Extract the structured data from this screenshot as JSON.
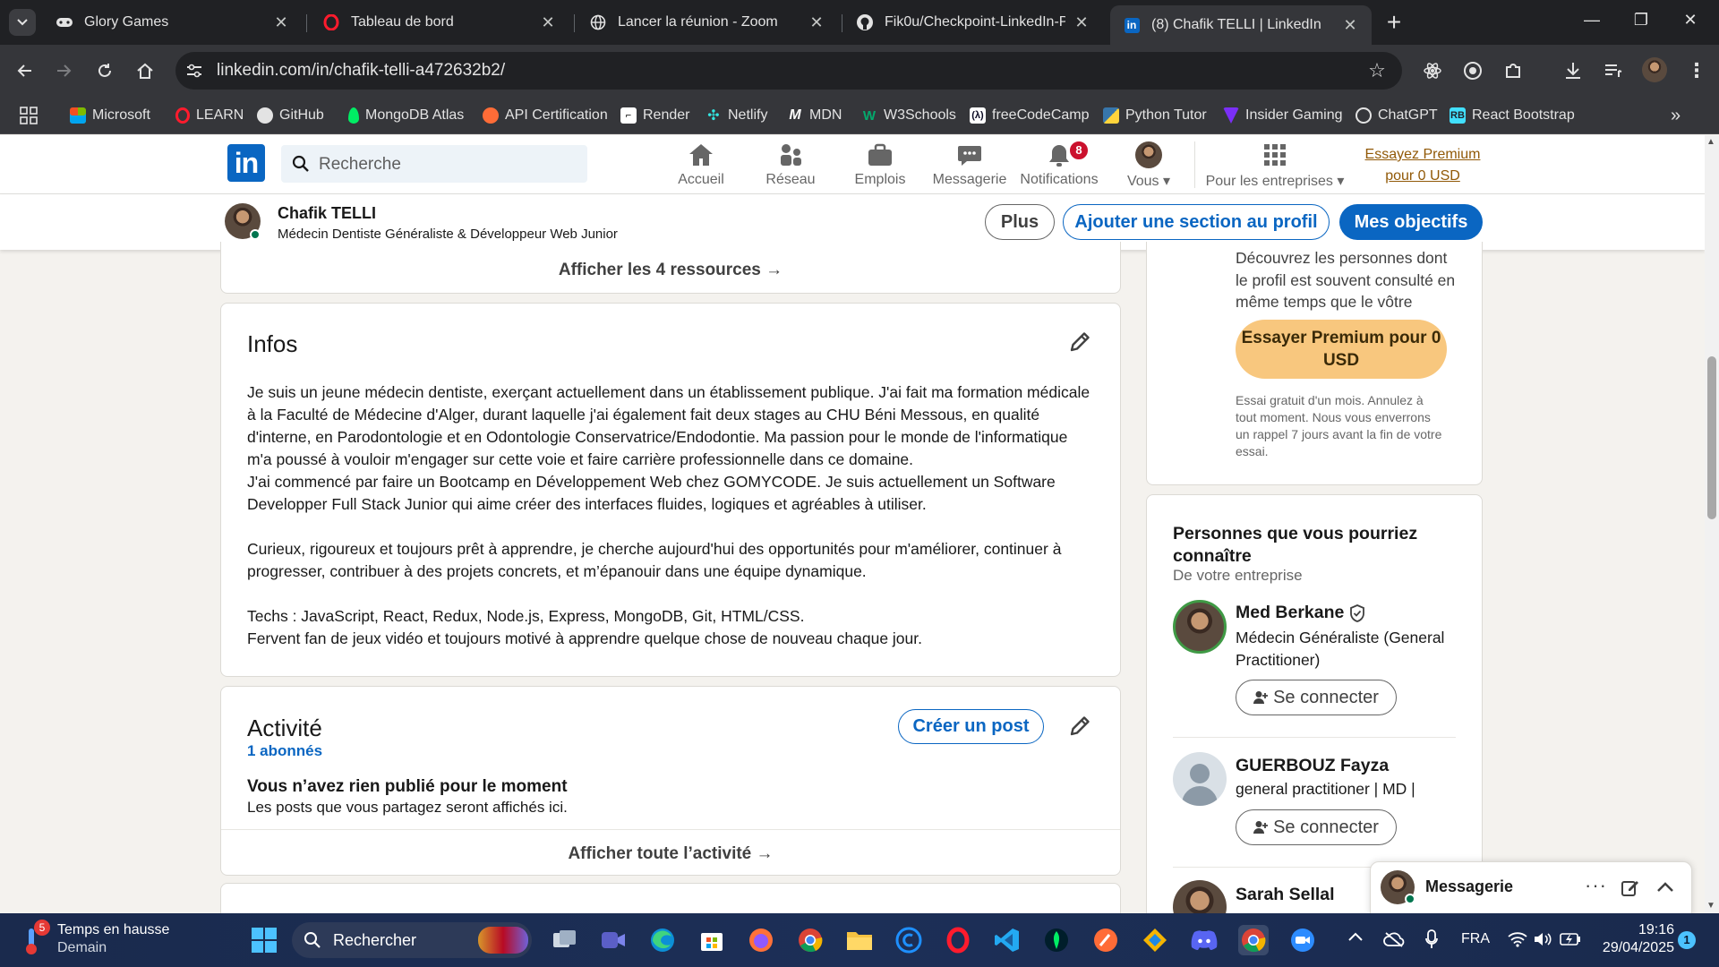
{
  "browser": {
    "tabs": [
      {
        "title": "Glory Games",
        "icon": "gamepad-icon"
      },
      {
        "title": "Tableau de bord",
        "icon": "opera-icon"
      },
      {
        "title": "Lancer la réunion - Zoom",
        "icon": "globe-icon"
      },
      {
        "title": "Fik0u/Checkpoint-LinkedIn-Pro",
        "icon": "github-icon"
      },
      {
        "title": "(8) Chafik TELLI | LinkedIn",
        "icon": "linkedin-icon",
        "active": true
      }
    ],
    "new_tab_label": "+",
    "url": "linkedin.com/in/chafik-telli-a472632b2/",
    "bookmarks": [
      "Microsoft",
      "LEARN",
      "GitHub",
      "MongoDB Atlas",
      "API Certification",
      "Render",
      "Netlify",
      "MDN",
      "W3Schools",
      "freeCodeCamp",
      "Python Tutor",
      "Insider Gaming",
      "ChatGPT",
      "React Bootstrap"
    ]
  },
  "linkedin": {
    "search_placeholder": "Recherche",
    "nav": {
      "home": "Accueil",
      "network": "Réseau",
      "jobs": "Emplois",
      "messaging": "Messagerie",
      "notifications": "Notifications",
      "notifications_count": "8",
      "me": "Vous",
      "business": "Pour les entreprises"
    },
    "premium_link": "Essayez Premium pour 0 USD",
    "profile_bar": {
      "name": "Chafik TELLI",
      "headline": "Médecin Dentiste Généraliste & Développeur Web Junior",
      "more": "Plus",
      "add_section": "Ajouter une section au profil",
      "goals": "Mes objectifs"
    },
    "resources_link": "Afficher les 4 ressources →",
    "about": {
      "title": "Infos",
      "p1": "Je suis un jeune médecin dentiste, exerçant actuellement dans un établissement publique. J'ai fait ma formation médicale à la Faculté de Médecine d'Alger, durant laquelle j'ai également fait deux stages au CHU Béni Messous, en qualité d'interne, en Parodontologie et en Odontologie Conservatrice/Endodontie. Ma passion pour le monde de l'informatique m'a poussé à vouloir m'engager sur cette voie et faire carrière professionnelle dans ce domaine.",
      "p2": "J'ai commencé par faire un Bootcamp en Développement Web chez GOMYCODE. Je suis actuellement un Software Developper Full Stack Junior qui aime créer des interfaces fluides, logiques et agréables à utiliser.",
      "p3": "Curieux, rigoureux et toujours prêt à apprendre, je cherche aujourd'hui des opportunités pour m'améliorer, continuer à progresser, contribuer à des projets concrets, et m’épanouir dans une équipe dynamique.",
      "p4": "Techs : JavaScript, React, Redux, Node.js, Express, MongoDB, Git, HTML/CSS.",
      "p5": "Fervent fan de jeux vidéo et toujours motivé à apprendre quelque chose de nouveau chaque jour."
    },
    "activity": {
      "title": "Activité",
      "followers": "1 abonnés",
      "create_post": "Créer un post",
      "empty_title": "Vous n’avez rien publié pour le moment",
      "empty_sub": "Les posts que vous partagez seront affichés ici.",
      "show_all": "Afficher toute l’activité →"
    },
    "premium_card": {
      "text": "Découvrez les personnes dont le profil est souvent consulté en même temps que le vôtre",
      "button": "Essayer Premium pour 0 USD",
      "note": "Essai gratuit d'un mois. Annulez à tout moment. Nous vous enverrons un rappel 7 jours avant la fin de votre essai."
    },
    "pymk": {
      "title": "Personnes que vous pourriez connaître",
      "subtitle": "De votre entreprise",
      "people": [
        {
          "name": "Med Berkane",
          "headline": "Médecin Généraliste (General Practitioner)",
          "verified": true
        },
        {
          "name": "GUERBOUZ Fayza",
          "headline": "general practitioner | MD |"
        },
        {
          "name": "Sarah Sellal",
          "headline": ""
        }
      ],
      "connect": "Se connecter"
    },
    "messaging_title": "Messagerie"
  },
  "taskbar": {
    "weather_badge": "5",
    "weather_title": "Temps en hausse",
    "weather_sub": "Demain",
    "search": "Rechercher",
    "lang": "FRA",
    "time": "19:16",
    "date": "29/04/2025",
    "notif_count": "1"
  }
}
